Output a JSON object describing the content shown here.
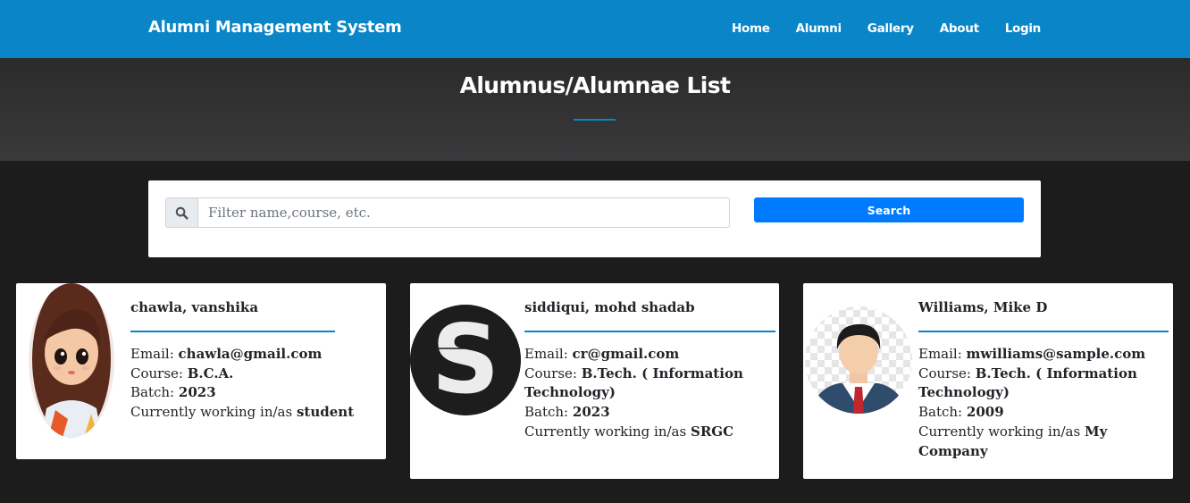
{
  "navbar": {
    "brand": "Alumni Management System",
    "links": [
      "Home",
      "Alumni",
      "Gallery",
      "About",
      "Login"
    ]
  },
  "header": {
    "title": "Alumnus/Alumnae List"
  },
  "search": {
    "placeholder": "Filter name,course, etc.",
    "value": "",
    "button_label": "Search",
    "icon": "search-icon"
  },
  "labels": {
    "email": "Email:",
    "course": "Course:",
    "batch": "Batch:",
    "working": "Currently working in/as"
  },
  "alumni": [
    {
      "name": "chawla, vanshika",
      "email": "chawla@gmail.com",
      "course": "B.C.A.",
      "batch": "2023",
      "working": "student",
      "avatar": "cartoon-girl-avatar"
    },
    {
      "name": "siddiqui, mohd shadab",
      "email": "cr@gmail.com",
      "course": "B.Tech. ( Information Technology)",
      "batch": "2023",
      "working": "SRGC",
      "avatar": "letter-s-avatar",
      "avatar_letter": "S"
    },
    {
      "name": "Williams, Mike D",
      "email": "mwilliams@sample.com",
      "course": "B.Tech. ( Information Technology)",
      "batch": "2009",
      "working": "My Company",
      "avatar": "businessman-avatar"
    }
  ],
  "colors": {
    "navbar": "#0a86c8",
    "accent": "#0a86c8",
    "button": "#007bff",
    "masthead": "#333333",
    "page_bg": "#1c1c1c"
  }
}
